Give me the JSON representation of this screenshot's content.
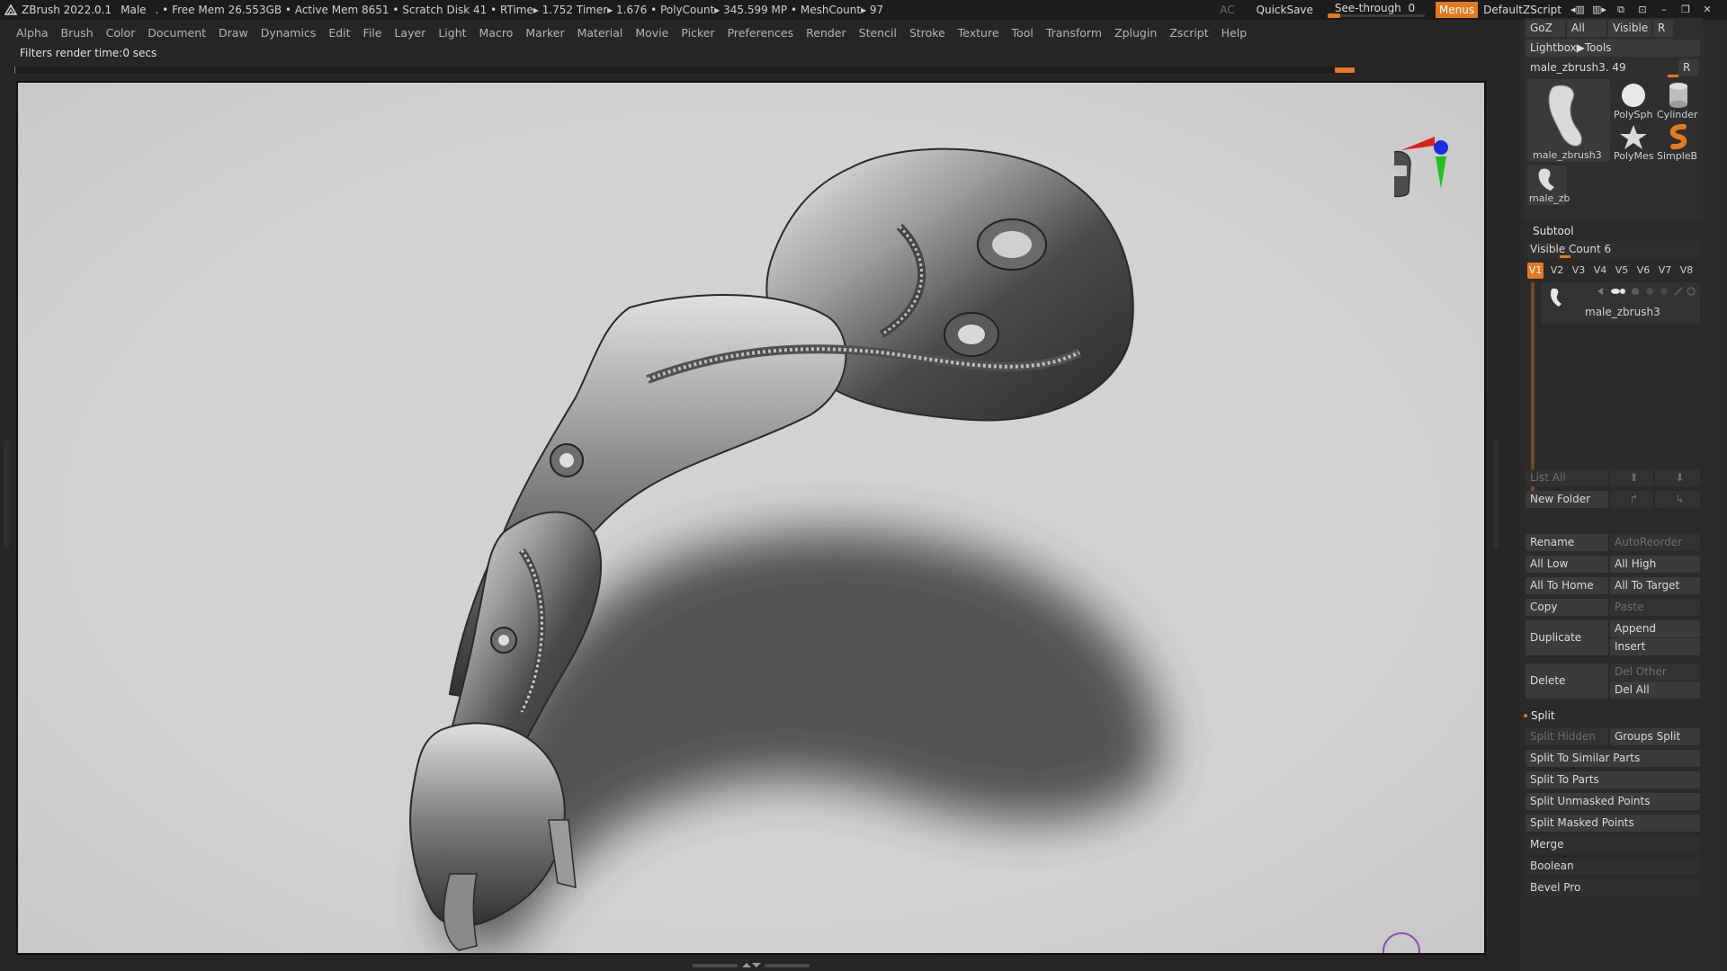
{
  "titlebar": {
    "app": "ZBrush 2022.0.1",
    "doc": "Male",
    "stats": ". • Free Mem 26.553GB • Active Mem 8651 • Scratch Disk 41 • RTime▸ 1.752 Timer▸ 1.676 • PolyCount▸ 345.599 MP • MeshCount▸ 97",
    "ac": "AC",
    "quicksave": "QuickSave",
    "seethrough_label": "See-through",
    "seethrough_value": "0",
    "seethrough_level": 0,
    "menus": "Menus",
    "zscript": "DefaultZScript"
  },
  "menubar": {
    "items": [
      "Alpha",
      "Brush",
      "Color",
      "Document",
      "Draw",
      "Dynamics",
      "Edit",
      "File",
      "Layer",
      "Light",
      "Macro",
      "Marker",
      "Material",
      "Movie",
      "Picker",
      "Preferences",
      "Render",
      "Stencil",
      "Stroke",
      "Texture",
      "Tool",
      "Transform",
      "Zplugin",
      "Zscript",
      "Help"
    ]
  },
  "status": {
    "message": "Filters render time:0 secs"
  },
  "tool_panel": {
    "goz": "GoZ",
    "all": "All",
    "visible": "Visible",
    "r": "R",
    "lightbox": "Lightbox▶Tools",
    "current_tool": "male_zbrush3. 49",
    "tools": {
      "main": "male_zbrush3",
      "polysphere": "PolySph",
      "cylinder": "Cylinder",
      "polymesh": "PolyMes",
      "simpleb": "SimpleB",
      "small": "male_zb"
    }
  },
  "subtool": {
    "title": "Subtool",
    "visible_count_label": "Visible Count",
    "visible_count": "6",
    "versions": [
      "V1",
      "V2",
      "V3",
      "V4",
      "V5",
      "V6",
      "V7",
      "V8"
    ],
    "active_version": "V1",
    "item_name": "male_zbrush3",
    "list_all": "List All",
    "new_folder": "New Folder",
    "rename": "Rename",
    "auto_reorder": "AutoReorder",
    "all_low": "All Low",
    "all_high": "All High",
    "all_to_home": "All To Home",
    "all_to_target": "All To Target",
    "copy": "Copy",
    "paste": "Paste",
    "duplicate": "Duplicate",
    "append": "Append",
    "insert": "Insert",
    "delete": "Delete",
    "del_other": "Del Other",
    "del_all": "Del All",
    "split": "Split",
    "split_hidden": "Split Hidden",
    "groups_split": "Groups Split",
    "split_similar": "Split To Similar Parts",
    "split_parts": "Split To Parts",
    "split_unmasked": "Split Unmasked Points",
    "split_masked": "Split Masked Points",
    "merge": "Merge",
    "boolean": "Boolean",
    "bevel_pro": "Bevel Pro"
  },
  "colors": {
    "accent": "#e47a1e",
    "viewport_bg": "#d2d2d2",
    "axis_x": "#e02020",
    "axis_y": "#20c020",
    "axis_z": "#1a2ee0"
  }
}
